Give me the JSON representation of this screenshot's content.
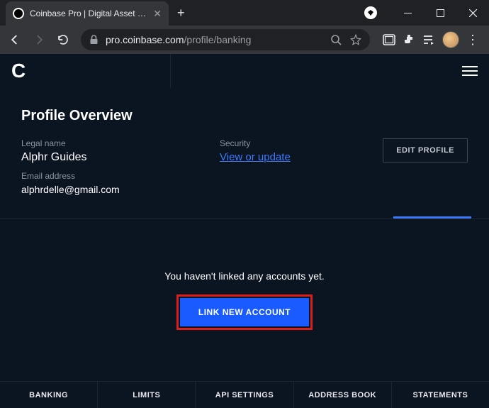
{
  "browser": {
    "tab_title": "Coinbase Pro | Digital Asset Exch",
    "url_host": "pro.coinbase.com",
    "url_path": "/profile/banking"
  },
  "page": {
    "heading": "Profile Overview",
    "legal_name_label": "Legal name",
    "legal_name": "Alphr Guides",
    "email_label": "Email address",
    "email": "alphrdelle@gmail.com",
    "security_label": "Security",
    "security_link": "View or update",
    "edit_profile": "EDIT PROFILE"
  },
  "banking": {
    "empty_msg": "You haven't linked any accounts yet.",
    "link_button": "LINK NEW ACCOUNT"
  },
  "tabs": {
    "banking": "BANKING",
    "limits": "LIMITS",
    "api": "API SETTINGS",
    "address_book": "ADDRESS BOOK",
    "statements": "STATEMENTS"
  }
}
